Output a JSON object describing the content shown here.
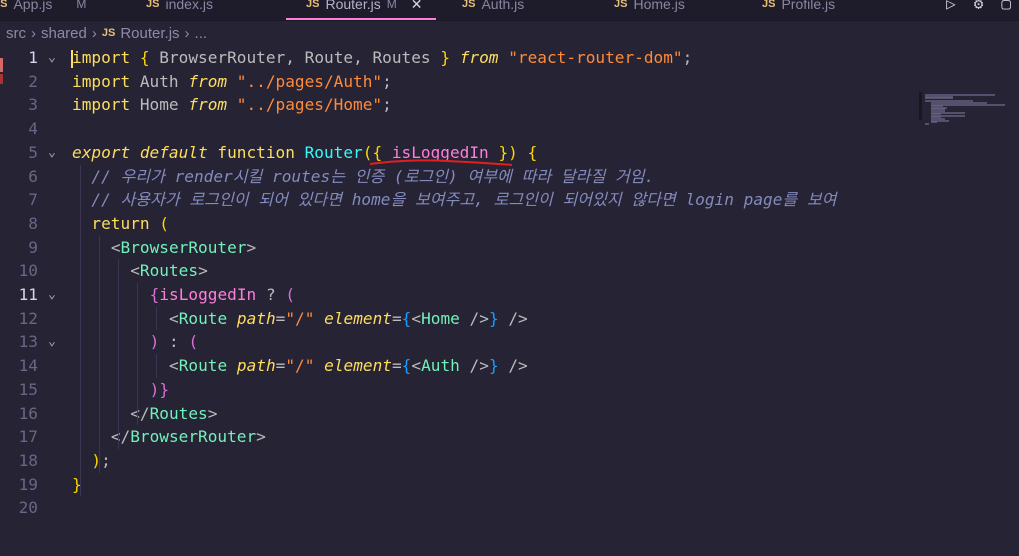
{
  "tabs": [
    {
      "label": "App.js",
      "modified": "M",
      "active": false
    },
    {
      "label": "index.js",
      "modified": "",
      "active": false
    },
    {
      "label": "Router.js",
      "modified": "M",
      "active": true
    },
    {
      "label": "Auth.js",
      "modified": "",
      "active": false
    },
    {
      "label": "Home.js",
      "modified": "",
      "active": false
    },
    {
      "label": "Profile.js",
      "modified": "",
      "active": false
    }
  ],
  "breadcrumb": {
    "folder1": "src",
    "folder2": "shared",
    "file_icon": "JS",
    "file": "Router.js",
    "more": "..."
  },
  "editor": {
    "language_icon": "JS",
    "lines": [
      {
        "n": "1",
        "text": "import { BrowserRouter, Route, Routes } from \"react-router-dom\";"
      },
      {
        "n": "2",
        "text": "import Auth from \"../pages/Auth\";"
      },
      {
        "n": "3",
        "text": "import Home from \"../pages/Home\";"
      },
      {
        "n": "4",
        "text": ""
      },
      {
        "n": "5",
        "text": "export default function Router({ isLoggedIn }) {"
      },
      {
        "n": "6",
        "text": "  // 우리가 render시킬 routes는 인증 (로그인) 여부에 따라 달라질 거임."
      },
      {
        "n": "7",
        "text": "  // 사용자가 로그인이 되어 있다면 home을 보여주고, 로그인이 되어있지 않다면 login page를 보여"
      },
      {
        "n": "8",
        "text": "  return ("
      },
      {
        "n": "9",
        "text": "    <BrowserRouter>"
      },
      {
        "n": "10",
        "text": "      <Routes>"
      },
      {
        "n": "11",
        "text": "        {isLoggedIn ? ("
      },
      {
        "n": "12",
        "text": "          <Route path=\"/\" element={<Home />} />"
      },
      {
        "n": "13",
        "text": "        ) : ("
      },
      {
        "n": "14",
        "text": "          <Route path=\"/\" element={<Auth />} />"
      },
      {
        "n": "15",
        "text": "        )}"
      },
      {
        "n": "16",
        "text": "      </Routes>"
      },
      {
        "n": "17",
        "text": "    </BrowserRouter>"
      },
      {
        "n": "18",
        "text": "  );"
      },
      {
        "n": "19",
        "text": "}"
      },
      {
        "n": "20",
        "text": ""
      }
    ]
  },
  "colors": {
    "background": "#262335",
    "keyword": "#fede5d",
    "string": "#ff8b39",
    "identifier": "#ff7edb",
    "function": "#36f9f6",
    "comment": "#848bbd",
    "tag": "#72f1b8",
    "error_squiggle": "#e02020"
  }
}
